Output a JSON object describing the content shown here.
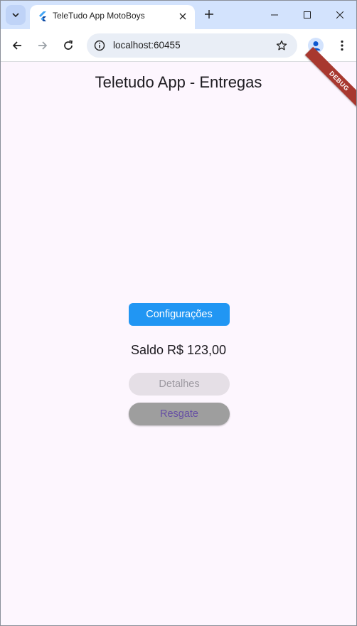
{
  "browser": {
    "tab_title": "TeleTudo App MotoBoys",
    "url": "localhost:60455"
  },
  "app": {
    "title": "Teletudo App - Entregas",
    "debug_banner": "DEBUG",
    "config_button": "Configurações",
    "balance_text": "Saldo R$ 123,00",
    "details_button": "Detalhes",
    "redeem_button": "Resgate"
  },
  "colors": {
    "tabstrip": "#d3e3fd",
    "app_background": "#fdf6fe",
    "config_button": "#2196f3",
    "debug_banner": "#a8382f",
    "redeem_button": "#9e9e9e",
    "redeem_text": "#6750a4"
  },
  "icons": {
    "tab_search": "chevron-down-icon",
    "favicon": "flutter-icon",
    "tab_close": "close-icon",
    "new_tab": "plus-icon",
    "minimize": "minimize-icon",
    "maximize": "maximize-icon",
    "close_window": "close-icon",
    "back": "arrow-left-icon",
    "forward": "arrow-right-icon",
    "reload": "reload-icon",
    "site_info": "info-icon",
    "bookmark": "star-icon",
    "profile": "person-icon",
    "menu": "kebab-menu-icon"
  }
}
